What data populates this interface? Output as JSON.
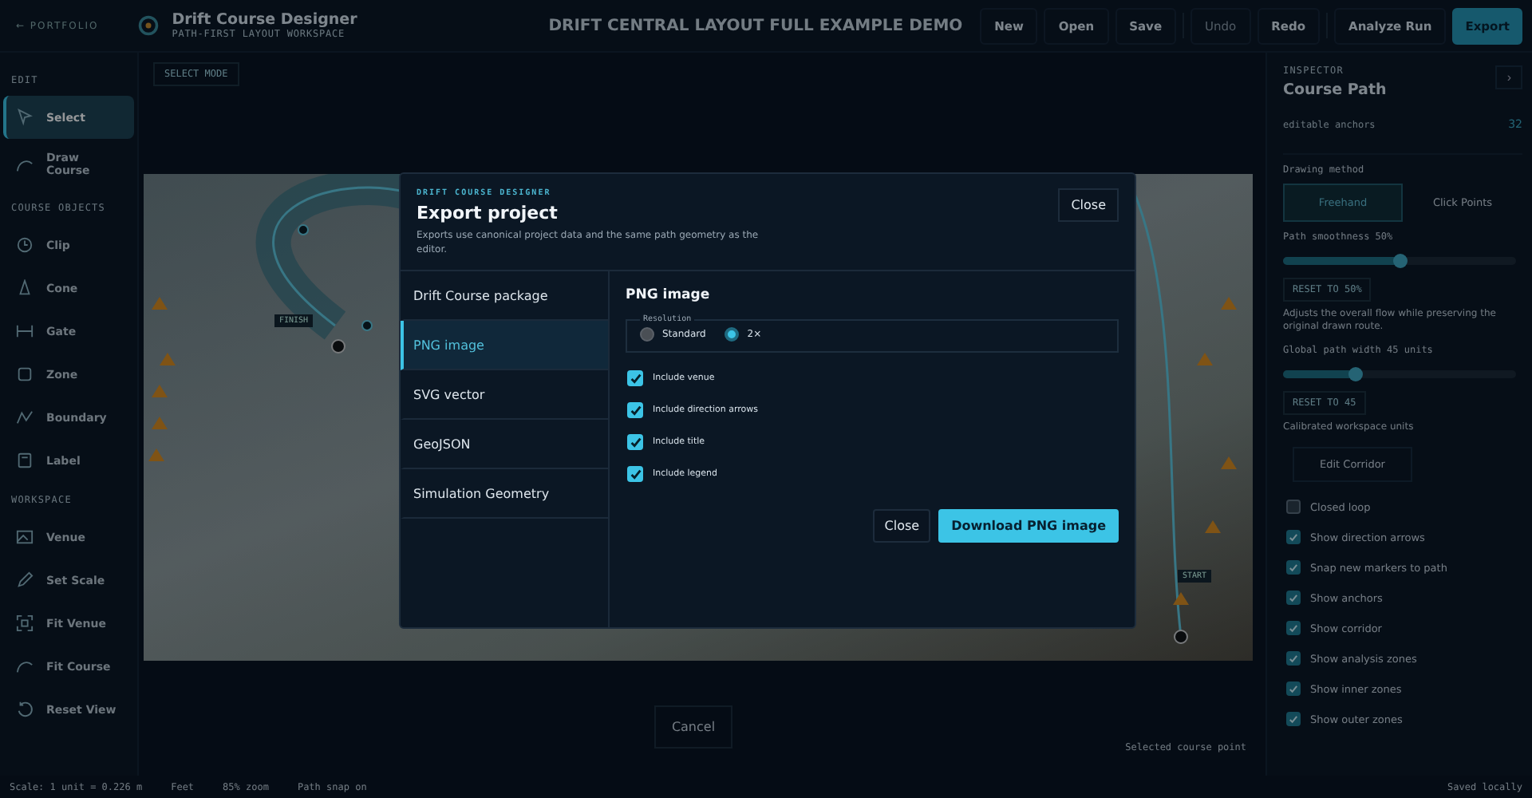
{
  "topbar": {
    "back_link": "← PORTFOLIO",
    "app_title": "Drift Course Designer",
    "app_subtitle": "PATH-FIRST LAYOUT WORKSPACE",
    "project_title": "DRIFT CENTRAL LAYOUT FULL EXAMPLE DEMO",
    "actions": [
      {
        "label": "New",
        "disabled": false,
        "primary": false
      },
      {
        "label": "Open",
        "disabled": false,
        "primary": false
      },
      {
        "label": "Save",
        "disabled": false,
        "primary": false
      },
      {
        "label": "Undo",
        "disabled": true,
        "primary": false
      },
      {
        "label": "Redo",
        "disabled": false,
        "primary": false
      },
      {
        "label": "Analyze Run",
        "disabled": false,
        "primary": false
      },
      {
        "label": "Export",
        "disabled": false,
        "primary": true
      }
    ]
  },
  "sidebar": {
    "sections": [
      {
        "heading": "EDIT",
        "items": [
          {
            "label": "Select",
            "selected": true
          },
          {
            "label": "Draw Course",
            "selected": false
          }
        ]
      },
      {
        "heading": "COURSE OBJECTS",
        "items": [
          {
            "label": "Clip",
            "selected": false
          },
          {
            "label": "Cone",
            "selected": false
          },
          {
            "label": "Gate",
            "selected": false
          },
          {
            "label": "Zone",
            "selected": false
          },
          {
            "label": "Boundary",
            "selected": false
          },
          {
            "label": "Label",
            "selected": false
          }
        ]
      },
      {
        "heading": "WORKSPACE",
        "items": [
          {
            "label": "Venue",
            "selected": false
          },
          {
            "label": "Set Scale",
            "selected": false
          },
          {
            "label": "Fit Venue",
            "selected": false
          },
          {
            "label": "Fit Course",
            "selected": false
          },
          {
            "label": "Reset View",
            "selected": false
          }
        ]
      }
    ]
  },
  "canvas": {
    "mode_chip": "SELECT MODE",
    "map_labels": [
      {
        "text": "FINISH"
      },
      {
        "text": "START"
      }
    ],
    "cancel_button": "Cancel",
    "hint": "Selected course point"
  },
  "inspector": {
    "eyebrow": "INSPECTOR",
    "title": "Course Path",
    "collapse_button": "›",
    "stat_label": "editable anchors",
    "stat_value": "32",
    "method_label": "Drawing method",
    "methods": [
      {
        "label": "Freehand",
        "selected": true
      },
      {
        "label": "Click Points",
        "selected": false
      }
    ],
    "sliders": [
      {
        "label": "Path smoothness 50%",
        "level": 0.5,
        "reset": "RESET TO 50%",
        "help": "Adjusts the overall flow while preserving the original drawn route."
      },
      {
        "label": "Global path width 45 units",
        "level": 0.31,
        "reset": "RESET TO 45",
        "help": "Calibrated workspace units"
      }
    ],
    "corridor_button": "Edit Corridor",
    "options": [
      {
        "label": "Closed loop",
        "checked": false
      },
      {
        "label": "Show direction arrows",
        "checked": true
      },
      {
        "label": "Snap new markers to path",
        "checked": true
      },
      {
        "label": "Show anchors",
        "checked": true
      },
      {
        "label": "Show corridor",
        "checked": true
      },
      {
        "label": "Show analysis zones",
        "checked": true
      },
      {
        "label": "Show inner zones",
        "checked": true
      },
      {
        "label": "Show outer zones",
        "checked": true
      }
    ]
  },
  "status_bar": {
    "items": [
      "Scale: 1 unit = 0.226 m",
      "Feet",
      "85% zoom",
      "Path snap on"
    ],
    "save_state": "Saved locally"
  },
  "dialog": {
    "eyebrow": "DRIFT COURSE DESIGNER",
    "title": "Export project",
    "description": "Exports use canonical project data and the same path geometry as the editor.",
    "close_button": "Close",
    "formats": [
      {
        "label": "Drift Course package",
        "selected": false
      },
      {
        "label": "PNG image",
        "selected": true
      },
      {
        "label": "SVG vector",
        "selected": false
      },
      {
        "label": "GeoJSON",
        "selected": false
      },
      {
        "label": "Simulation Geometry",
        "selected": false
      }
    ],
    "pane_title": "PNG image",
    "resolution_legend": "Resolution",
    "resolutions": [
      {
        "label": "Standard",
        "selected": false
      },
      {
        "label": "2×",
        "selected": true
      }
    ],
    "includes": [
      {
        "label": "Include venue",
        "checked": true
      },
      {
        "label": "Include direction arrows",
        "checked": true
      },
      {
        "label": "Include title",
        "checked": true
      },
      {
        "label": "Include legend",
        "checked": true
      }
    ],
    "cancel_button": "Close",
    "download_button": "Download PNG image"
  }
}
